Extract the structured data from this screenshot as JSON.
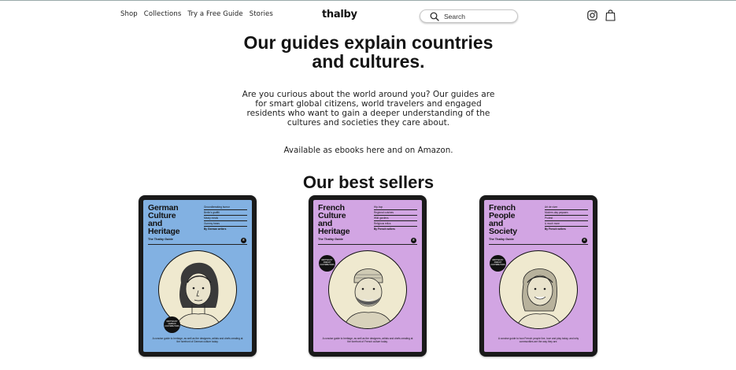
{
  "nav": [
    "Shop",
    "Collections",
    "Try a Free Guide",
    "Stories"
  ],
  "logo": "thalby",
  "search": {
    "placeholder": "Search"
  },
  "icons": {
    "search": "search-icon",
    "instagram": "instagram-icon",
    "cart": "shopping-bag-icon"
  },
  "headline": "Our guides explain countries and cultures.",
  "intro": "Are you curious about the world around you? Our guides are for smart global citizens, world travelers and engaged residents who want to gain a deeper understanding of the cultures and societies they care about.",
  "available": "Available as ebooks here and on Amazon.",
  "bestsellers_title": "Our best sellers",
  "colors": {
    "blue_cover": "#82b1e2",
    "pink_cover": "#d2a5e3",
    "tablet": "#1a1a1a"
  },
  "products": [
    {
      "title_lines": [
        "German",
        "Culture",
        "and",
        "Heritage"
      ],
      "bullets": [
        "Groundbreaking humor",
        "Berlin's graffiti",
        "Meaty meals",
        "Gummy bears"
      ],
      "byline": "By German writers",
      "series": "The Thalby Guide",
      "badge": "E",
      "seal": "WRITTEN BY GERMAN CONTRIBUTORS",
      "blurb": "A concise guide to heritage, as well as the designers, artists and chefs creating at the forefront of German culture today."
    },
    {
      "title_lines": [
        "French",
        "Culture",
        "and",
        "Heritage"
      ],
      "bullets": [
        "Hip-hop",
        "Regional cuisines",
        "Wild gardens",
        "Religious relics"
      ],
      "byline": "By French writers",
      "series": "The Thalby Guide",
      "badge": "E",
      "seal": "WRITTEN BY FRENCH CONTRIBUTORS",
      "blurb": "A concise guide to heritage, as well as the designers, artists and chefs creating at the forefront of French culture today."
    },
    {
      "title_lines": [
        "French",
        "People",
        "and",
        "Society"
      ],
      "bullets": [
        "Art de vivre",
        "Modern-day paysans",
        "Protest",
        "& much more"
      ],
      "byline": "By French writers",
      "series": "The Thalby Guide",
      "badge": "E",
      "seal": "WRITTEN BY FRENCH CONTRIBUTORS",
      "blurb": "A concise guide to how French people live, love and play today, and why communities are the way they are."
    }
  ]
}
